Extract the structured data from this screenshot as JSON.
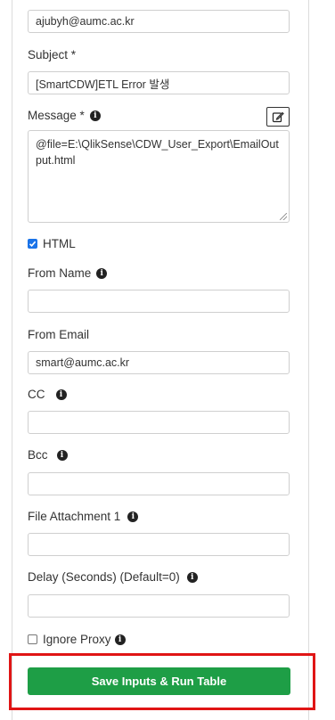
{
  "fields": {
    "to_value": "ajubyh@aumc.ac.kr",
    "subject_label": "Subject *",
    "subject_value": "[SmartCDW]ETL Error 발생",
    "message_label": "Message *",
    "message_value": "@file=E:\\QlikSense\\CDW_User_Export\\EmailOutput.html",
    "html_label": "HTML",
    "html_checked": true,
    "from_name_label": "From Name",
    "from_name_value": "",
    "from_email_label": "From Email",
    "from_email_value": "smart@aumc.ac.kr",
    "cc_label": "CC",
    "cc_value": "",
    "bcc_label": "Bcc",
    "bcc_value": "",
    "attachment_label": "File Attachment 1",
    "attachment_value": "",
    "delay_label": "Delay (Seconds) (Default=0)",
    "delay_value": "",
    "ignore_proxy_label": "Ignore Proxy",
    "ignore_proxy_checked": false
  },
  "actions": {
    "run_label": "Save Inputs & Run Table"
  },
  "colors": {
    "primary_button": "#1e9e46",
    "highlight_border": "#e01515",
    "checkbox_checked": "#1a73e8"
  },
  "icons": {
    "info": "info-icon",
    "edit": "edit-icon"
  }
}
